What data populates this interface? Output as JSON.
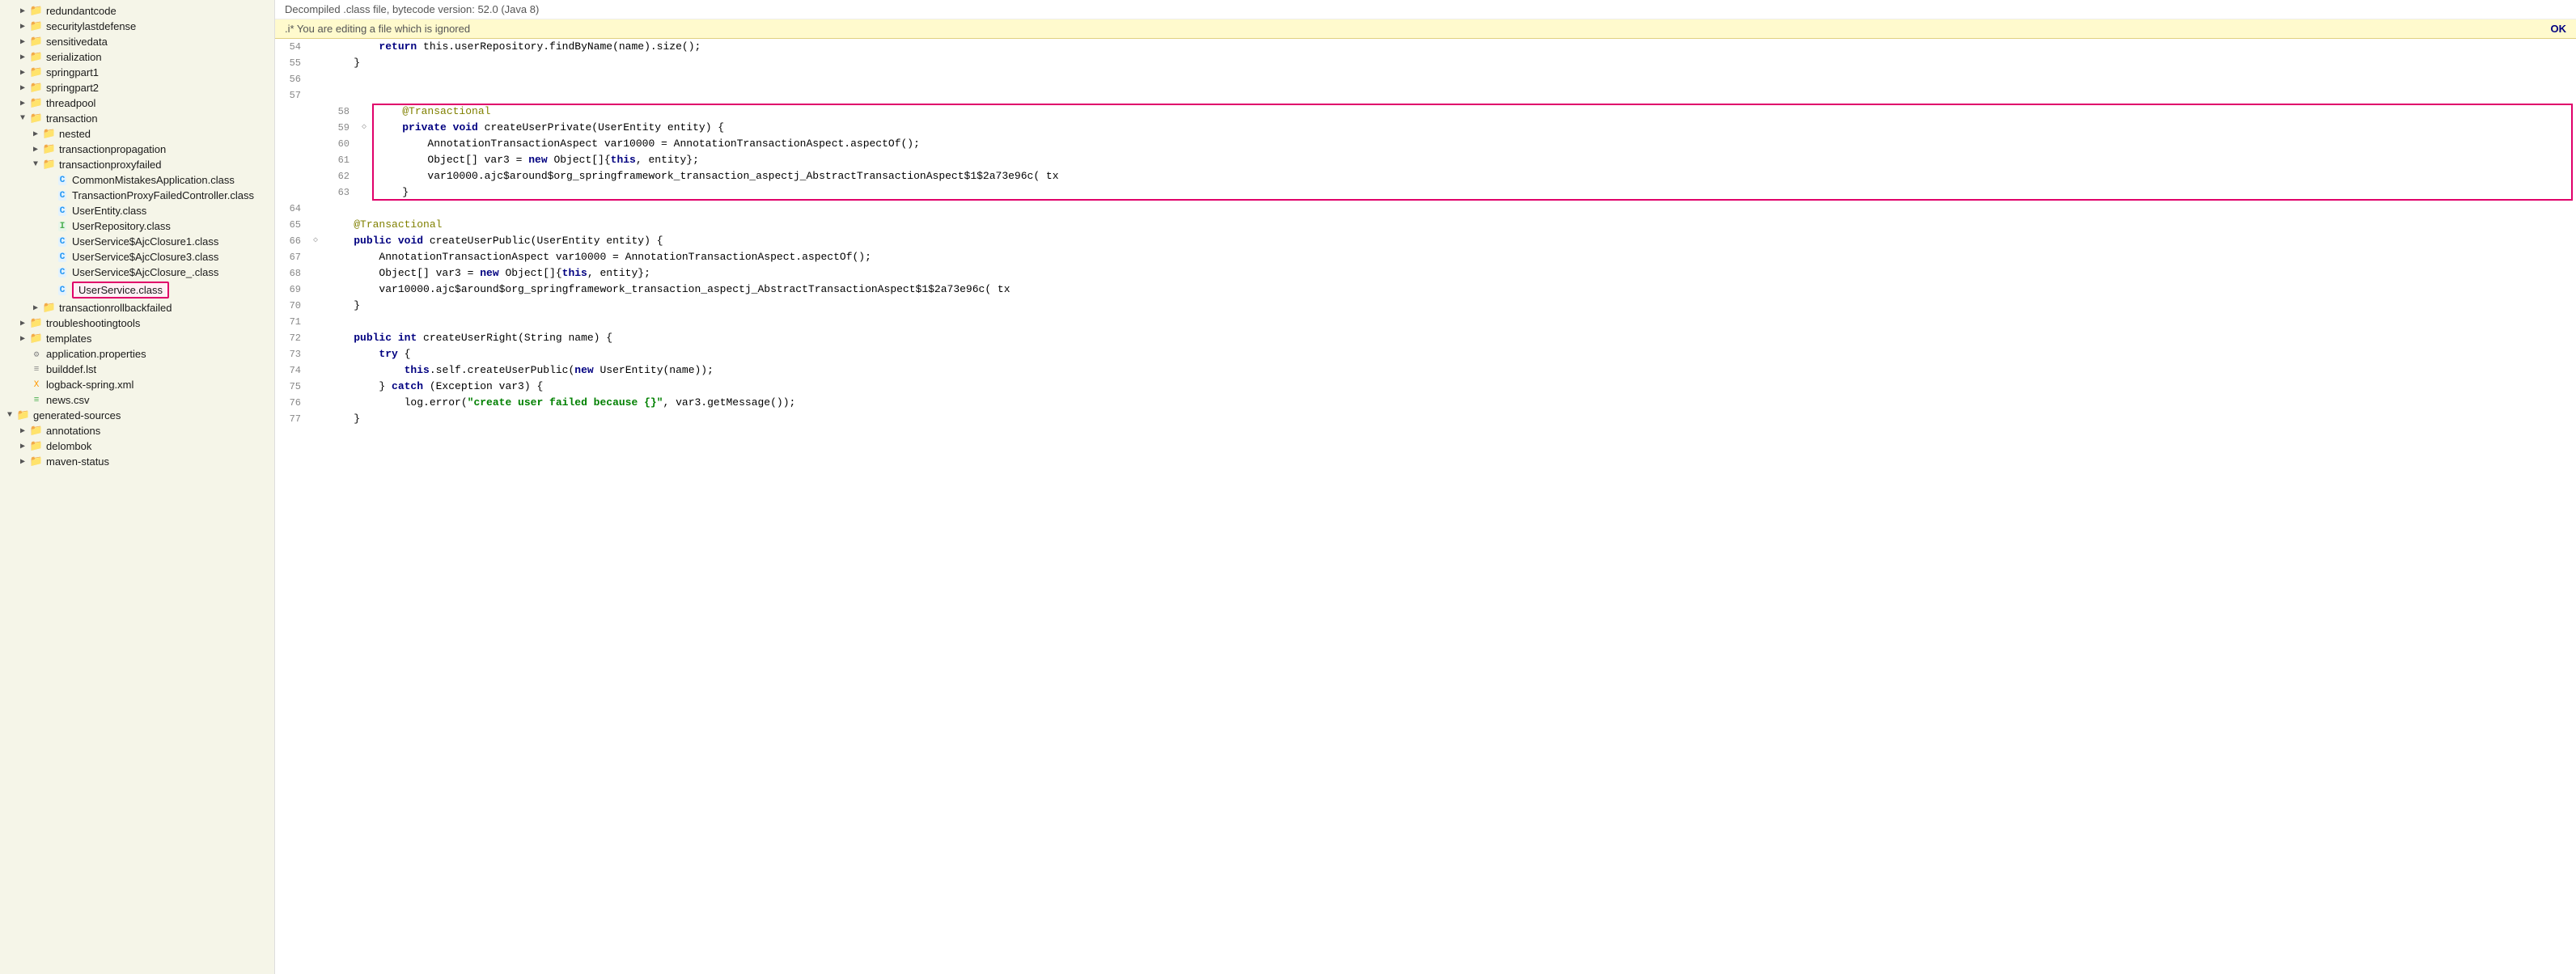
{
  "sidebar": {
    "items": [
      {
        "id": "redundantcode",
        "label": "redundantcode",
        "type": "folder",
        "indent": 1,
        "arrow": "▶"
      },
      {
        "id": "securitylastdefense",
        "label": "securitylastdefense",
        "type": "folder",
        "indent": 1,
        "arrow": "▶"
      },
      {
        "id": "sensitivedata",
        "label": "sensitivedata",
        "type": "folder",
        "indent": 1,
        "arrow": "▶"
      },
      {
        "id": "serialization",
        "label": "serialization",
        "type": "folder",
        "indent": 1,
        "arrow": "▶"
      },
      {
        "id": "springpart1",
        "label": "springpart1",
        "type": "folder",
        "indent": 1,
        "arrow": "▶"
      },
      {
        "id": "springpart2",
        "label": "springpart2",
        "type": "folder",
        "indent": 1,
        "arrow": "▶"
      },
      {
        "id": "threadpool",
        "label": "threadpool",
        "type": "folder",
        "indent": 1,
        "arrow": "▶"
      },
      {
        "id": "transaction",
        "label": "transaction",
        "type": "folder-open",
        "indent": 1,
        "arrow": "▼"
      },
      {
        "id": "nested",
        "label": "nested",
        "type": "folder",
        "indent": 2,
        "arrow": "▶"
      },
      {
        "id": "transactionpropagation",
        "label": "transactionpropagation",
        "type": "folder",
        "indent": 2,
        "arrow": "▶"
      },
      {
        "id": "transactionproxyfailed",
        "label": "transactionproxyfailed",
        "type": "folder-open",
        "indent": 2,
        "arrow": "▼"
      },
      {
        "id": "CommonMistakesApplication",
        "label": "CommonMistakesApplication.class",
        "type": "file-c",
        "indent": 3
      },
      {
        "id": "TransactionProxyFailedController",
        "label": "TransactionProxyFailedController.class",
        "type": "file-c",
        "indent": 3
      },
      {
        "id": "UserEntity",
        "label": "UserEntity.class",
        "type": "file-c",
        "indent": 3
      },
      {
        "id": "UserRepository",
        "label": "UserRepository.class",
        "type": "file-i",
        "indent": 3
      },
      {
        "id": "UserServiceAjcClosure1",
        "label": "UserService$AjcClosure1.class",
        "type": "file-c",
        "indent": 3
      },
      {
        "id": "UserServiceAjcClosure3",
        "label": "UserService$AjcClosure3.class",
        "type": "file-c",
        "indent": 3
      },
      {
        "id": "UserServiceAjcClosure_",
        "label": "UserService$AjcClosure_.class",
        "type": "file-c",
        "indent": 3
      },
      {
        "id": "UserService",
        "label": "UserService.class",
        "type": "file-c",
        "indent": 3,
        "selected": true,
        "highlighted": true
      },
      {
        "id": "transactionrollbackfailed",
        "label": "transactionrollbackfailed",
        "type": "folder",
        "indent": 2,
        "arrow": "▶"
      },
      {
        "id": "troubleshootingtools",
        "label": "troubleshootingtools",
        "type": "folder",
        "indent": 1,
        "arrow": "▶"
      },
      {
        "id": "templates",
        "label": "templates",
        "type": "folder",
        "indent": 1,
        "arrow": "▶"
      },
      {
        "id": "application.properties",
        "label": "application.properties",
        "type": "file-props",
        "indent": 1
      },
      {
        "id": "builddef.lst",
        "label": "builddef.lst",
        "type": "file-lst",
        "indent": 1
      },
      {
        "id": "logback-spring.xml",
        "label": "logback-spring.xml",
        "type": "file-xml",
        "indent": 1
      },
      {
        "id": "news.csv",
        "label": "news.csv",
        "type": "file-csv",
        "indent": 1
      },
      {
        "id": "generated-sources",
        "label": "generated-sources",
        "type": "folder-open",
        "indent": 0,
        "arrow": "▼"
      },
      {
        "id": "annotations",
        "label": "annotations",
        "type": "folder",
        "indent": 1,
        "arrow": "▶"
      },
      {
        "id": "delombok",
        "label": "delombok",
        "type": "folder",
        "indent": 1,
        "arrow": "▶"
      },
      {
        "id": "maven-status",
        "label": "maven-status",
        "type": "folder",
        "indent": 1,
        "arrow": "▶"
      }
    ]
  },
  "header": {
    "info_bar": "Decompiled .class file, bytecode version: 52.0 (Java 8)",
    "warning_text": ".i* You are editing a file which is ignored",
    "ok_label": "OK"
  },
  "code": {
    "lines": [
      {
        "num": 54,
        "gutter": "",
        "content": "        <kw>return</kw> <plain>this.userRepository.findByName(name).size();</plain>"
      },
      {
        "num": 55,
        "gutter": "",
        "content": "    <plain>}</plain>"
      },
      {
        "num": 56,
        "gutter": "",
        "content": ""
      },
      {
        "num": 57,
        "gutter": "",
        "content": ""
      },
      {
        "num": 58,
        "gutter": "",
        "content": "    <annotation>@Transactional</annotation>",
        "highlight_start": true
      },
      {
        "num": 59,
        "gutter": "◇",
        "content": "    <kw>private</kw> <kw>void</kw> <plain>createUserPrivate(UserEntity entity) {</plain>"
      },
      {
        "num": 60,
        "gutter": "",
        "content": "        <plain>AnnotationTransactionAspect var10000 = AnnotationTransactionAspect.aspectOf();</plain>"
      },
      {
        "num": 61,
        "gutter": "",
        "content": "        <plain>Object[] var3 = <kw>new</kw> Object[]{<kw>this</kw>, entity};</plain>"
      },
      {
        "num": 62,
        "gutter": "",
        "content": "        <plain>var10000.ajc$around$org_springframework_transaction_aspectj_AbstractTransactionAspect$1$2a73e96c( tx</plain>"
      },
      {
        "num": 63,
        "gutter": "",
        "content": "    <plain>}</plain>",
        "highlight_end": true
      },
      {
        "num": 64,
        "gutter": "",
        "content": ""
      },
      {
        "num": 65,
        "gutter": "",
        "content": "    <annotation>@Transactional</annotation>"
      },
      {
        "num": 66,
        "gutter": "◇",
        "content": "    <kw>public</kw> <kw>void</kw> <plain>createUserPublic(UserEntity entity) {</plain>"
      },
      {
        "num": 67,
        "gutter": "",
        "content": "        <plain>AnnotationTransactionAspect var10000 = AnnotationTransactionAspect.aspectOf();</plain>"
      },
      {
        "num": 68,
        "gutter": "",
        "content": "        <plain>Object[] var3 = <kw>new</kw> Object[]{<kw>this</kw>, entity};</plain>"
      },
      {
        "num": 69,
        "gutter": "",
        "content": "        <plain>var10000.ajc$around$org_springframework_transaction_aspectj_AbstractTransactionAspect$1$2a73e96c( tx</plain>"
      },
      {
        "num": 70,
        "gutter": "",
        "content": "    <plain>}</plain>"
      },
      {
        "num": 71,
        "gutter": "",
        "content": ""
      },
      {
        "num": 72,
        "gutter": "",
        "content": "    <kw>public</kw> <kw>int</kw> <plain>createUserRight(String name) {</plain>"
      },
      {
        "num": 73,
        "gutter": "",
        "content": "        <kw>try</kw> <plain>{</plain>"
      },
      {
        "num": 74,
        "gutter": "",
        "content": "            <kw>this</kw><plain>.self.createUserPublic(<kw>new</kw> UserEntity(name));</plain>"
      },
      {
        "num": 75,
        "gutter": "",
        "content": "        <plain>} <kw>catch</kw> (Exception var3) {</plain>"
      },
      {
        "num": 76,
        "gutter": "",
        "content": "            <plain>log.error(<string>\"create user failed because {}\"</string>, var3.getMessage());</plain>"
      },
      {
        "num": 77,
        "gutter": "",
        "content": "    <plain>}</plain>"
      }
    ]
  }
}
